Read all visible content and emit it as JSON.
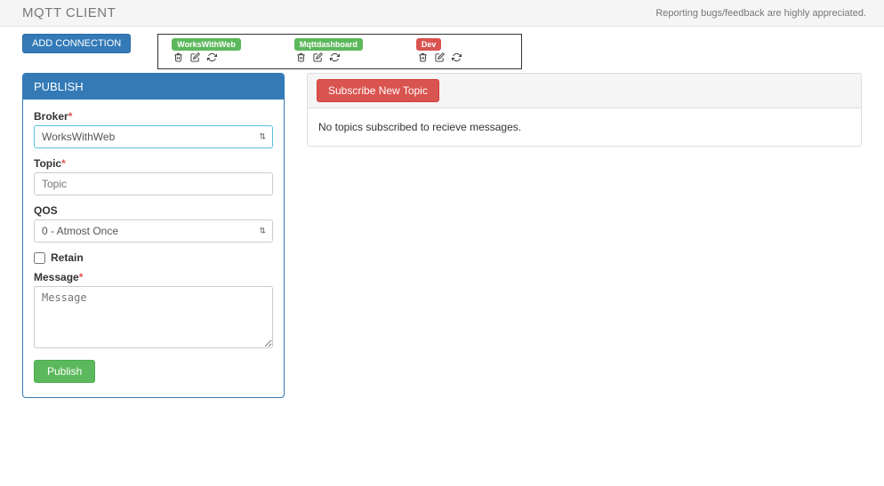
{
  "header": {
    "brand": "MQTT CLIENT",
    "feedback": "Reporting bugs/feedback are highly appreciated."
  },
  "toolbar": {
    "add_connection": "ADD CONNECTION"
  },
  "connections": [
    {
      "name": "WorksWithWeb",
      "status": "ok"
    },
    {
      "name": "Mqttdashboard",
      "status": "ok"
    },
    {
      "name": "Dev",
      "status": "error"
    }
  ],
  "publish": {
    "heading": "PUBLISH",
    "broker_label": "Broker",
    "broker_value": "WorksWithWeb",
    "topic_label": "Topic",
    "topic_placeholder": "Topic",
    "qos_label": "QOS",
    "qos_value": "0 - Atmost Once",
    "retain_label": "Retain",
    "message_label": "Message",
    "message_placeholder": "Message",
    "publish_btn": "Publish"
  },
  "subscribe": {
    "button": "Subscribe New Topic",
    "empty_text": "No topics subscribed to recieve messages."
  }
}
